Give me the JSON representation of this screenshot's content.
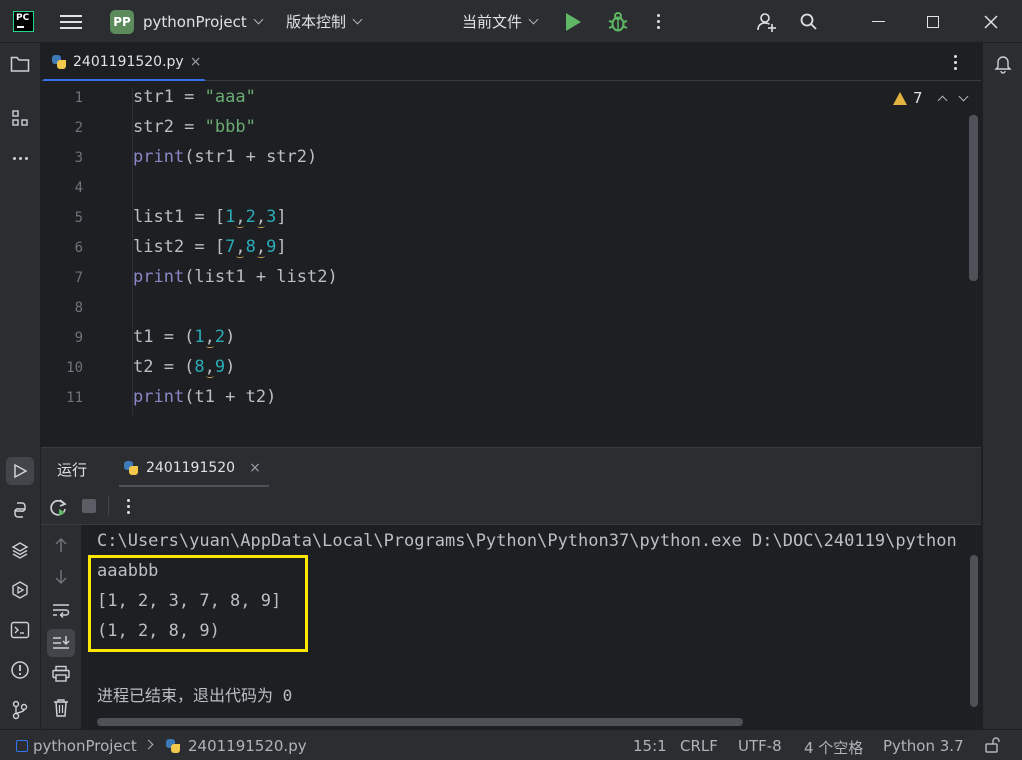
{
  "titlebar": {
    "app_logo_text": "PC",
    "project_badge": "PP",
    "project_name": "pythonProject",
    "vcs_label": "版本控制",
    "run_config": "当前文件",
    "icons": [
      "hamburger-menu-icon",
      "run-icon",
      "debug-icon",
      "more-icon",
      "add-user-icon",
      "search-icon",
      "minimize-icon",
      "maximize-icon",
      "close-icon"
    ]
  },
  "editor": {
    "tab_label": "2401191520.py",
    "tab_close": "×",
    "warning_count": "7",
    "line_numbers": [
      "1",
      "2",
      "3",
      "4",
      "5",
      "6",
      "7",
      "8",
      "9",
      "10",
      "11"
    ],
    "lines": [
      [
        {
          "t": "str1 = ",
          "c": "plain"
        },
        {
          "t": "\"aaa\"",
          "c": "str"
        }
      ],
      [
        {
          "t": "str2 = ",
          "c": "plain"
        },
        {
          "t": "\"bbb\"",
          "c": "str"
        }
      ],
      [
        {
          "t": "print",
          "c": "kw"
        },
        {
          "t": "(str1 + str2)",
          "c": "plain"
        }
      ],
      [],
      [
        {
          "t": "list1 = [",
          "c": "plain"
        },
        {
          "t": "1",
          "c": "num"
        },
        {
          "t": ",",
          "c": "comma"
        },
        {
          "t": "2",
          "c": "num"
        },
        {
          "t": ",",
          "c": "comma"
        },
        {
          "t": "3",
          "c": "num"
        },
        {
          "t": "]",
          "c": "plain"
        }
      ],
      [
        {
          "t": "list2 = [",
          "c": "plain"
        },
        {
          "t": "7",
          "c": "num"
        },
        {
          "t": ",",
          "c": "comma"
        },
        {
          "t": "8",
          "c": "num"
        },
        {
          "t": ",",
          "c": "comma"
        },
        {
          "t": "9",
          "c": "num"
        },
        {
          "t": "]",
          "c": "plain"
        }
      ],
      [
        {
          "t": "print",
          "c": "kw"
        },
        {
          "t": "(list1 + list2)",
          "c": "plain"
        }
      ],
      [],
      [
        {
          "t": "t1 = (",
          "c": "plain"
        },
        {
          "t": "1",
          "c": "num"
        },
        {
          "t": ",",
          "c": "comma"
        },
        {
          "t": "2",
          "c": "num"
        },
        {
          "t": ")",
          "c": "plain"
        }
      ],
      [
        {
          "t": "t2 = (",
          "c": "plain"
        },
        {
          "t": "8",
          "c": "num"
        },
        {
          "t": ",",
          "c": "comma"
        },
        {
          "t": "9",
          "c": "num"
        },
        {
          "t": ")",
          "c": "plain"
        }
      ],
      [
        {
          "t": "print",
          "c": "kw"
        },
        {
          "t": "(t1 + t2)",
          "c": "plain"
        }
      ]
    ]
  },
  "run_panel": {
    "title": "运行",
    "tab_label": "2401191520",
    "tab_close": "×",
    "output": {
      "command": "C:\\Users\\yuan\\AppData\\Local\\Programs\\Python\\Python37\\python.exe D:\\DOC\\240119\\python",
      "lines": [
        "aaabbb",
        "[1, 2, 3, 7, 8, 9]",
        "(1, 2, 8, 9)"
      ],
      "finish": "进程已结束，退出代码为 0"
    }
  },
  "statusbar": {
    "project": "pythonProject",
    "file": "2401191520.py",
    "position": "15:1",
    "line_sep": "CRLF",
    "encoding": "UTF-8",
    "indent": "4 个空格",
    "interpreter": "Python 3.7"
  },
  "colors": {
    "highlight_box": "#ffe600",
    "run_green": "#5fb865",
    "accent_blue": "#3574f0"
  }
}
